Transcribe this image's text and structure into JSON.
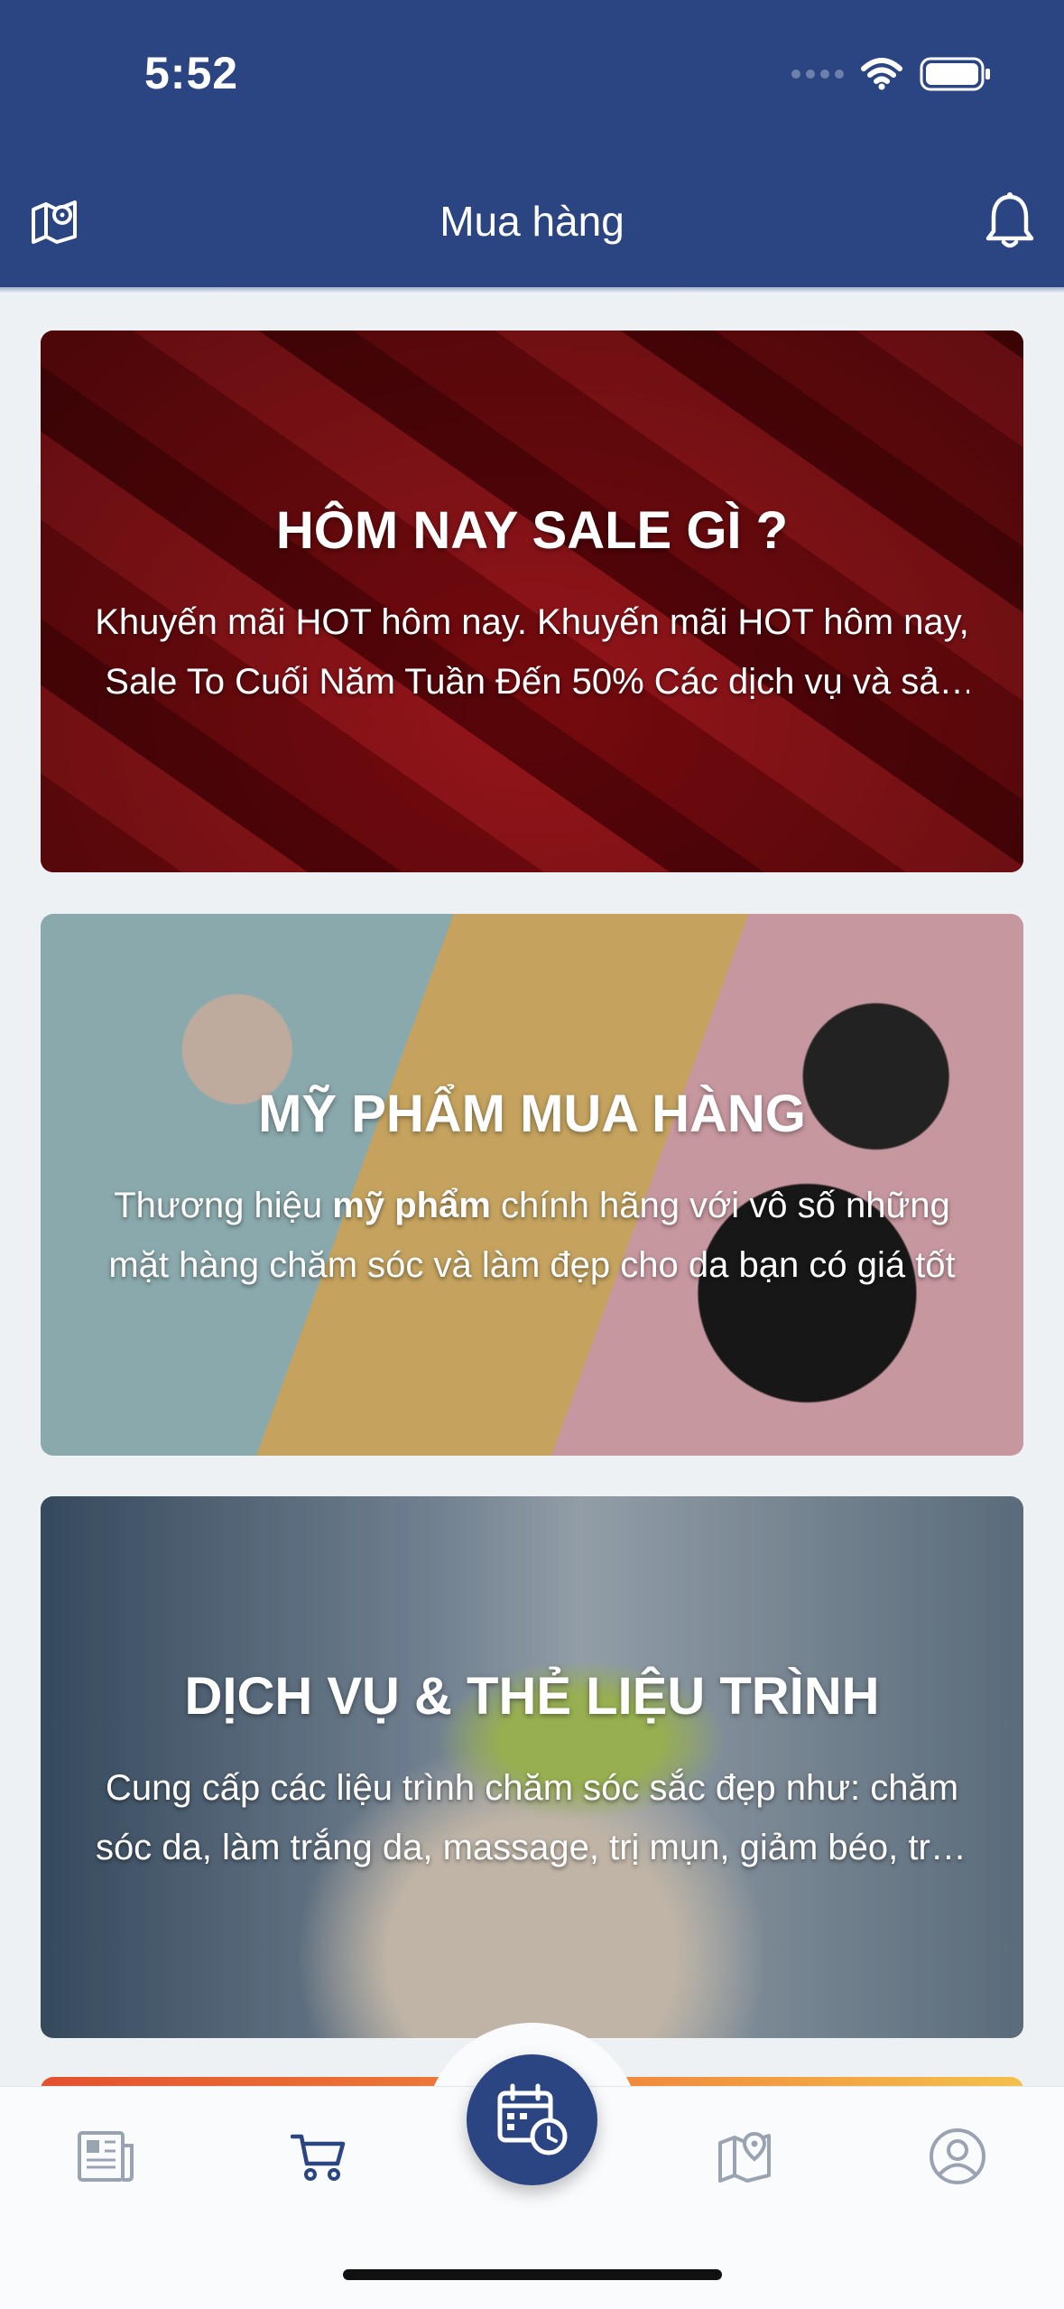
{
  "status_bar": {
    "time": "5:52"
  },
  "header": {
    "title": "Mua hàng"
  },
  "cards": [
    {
      "title": "HÔM NAY SALE GÌ ?",
      "description": "Khuyến mãi HOT hôm nay. Khuyến mãi HOT hôm nay, Sale To Cuối Năm Tuần Đến 50% Các dịch vụ và sản phẩm"
    },
    {
      "title": "MỸ PHẨM MUA HÀNG",
      "description_prefix": "Thương hiệu ",
      "description_bold": "mỹ phẩm",
      "description_suffix": " chính hãng với vô số những mặt hàng chăm sóc và làm đẹp cho da bạn có giá tốt"
    },
    {
      "title": "DỊCH VỤ & THẺ LIỆU TRÌNH",
      "description": "Cung cấp các liệu trình chăm sóc sắc đẹp như: chăm sóc da, làm trắng da, massage, trị mụn, giảm béo, triệt lông"
    }
  ],
  "bottom_nav": {
    "items": [
      {
        "icon": "newspaper-icon",
        "active": false
      },
      {
        "icon": "cart-icon",
        "active": true
      },
      {
        "icon": "calendar-clock-icon",
        "active": false
      },
      {
        "icon": "map-pin-icon",
        "active": false
      },
      {
        "icon": "user-circle-icon",
        "active": false
      }
    ]
  },
  "colors": {
    "primary": "#2b4482",
    "inactive_icon": "#9aa3b1",
    "background": "#eef1f4"
  }
}
